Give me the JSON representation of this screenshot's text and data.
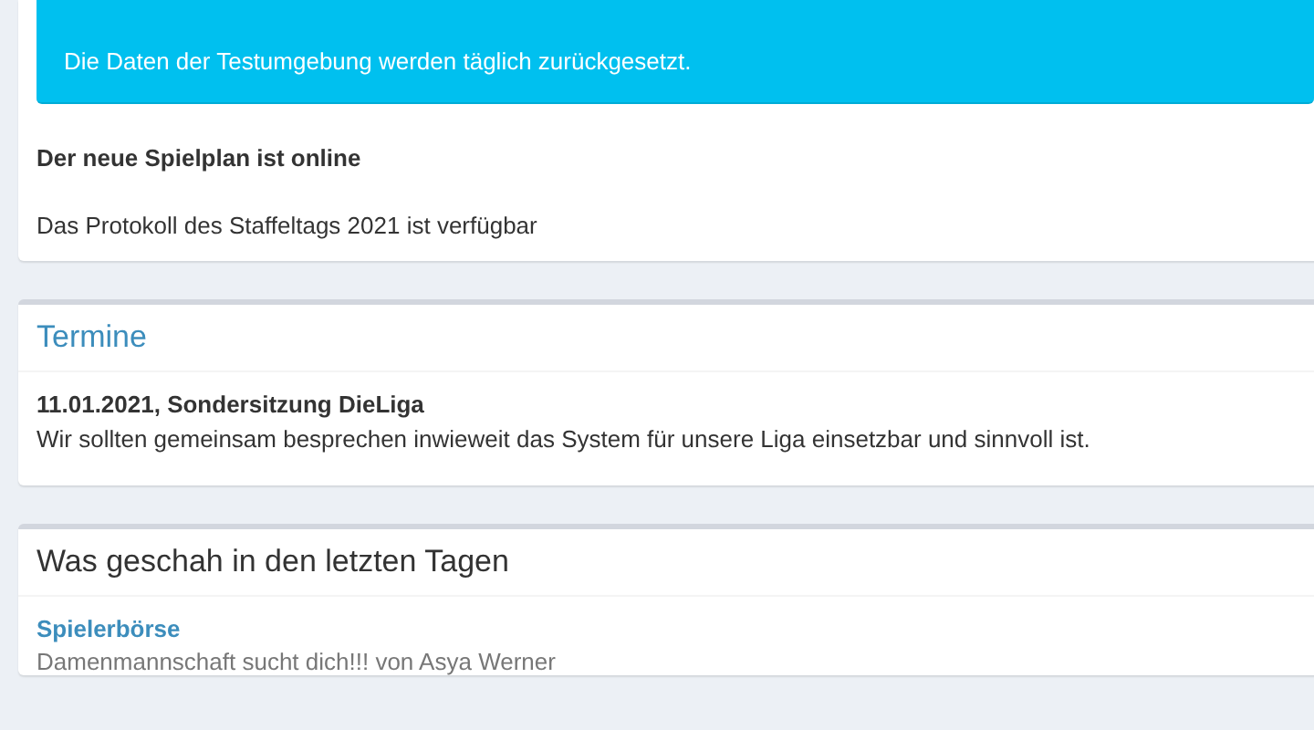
{
  "news_card": {
    "alert": "Die Daten der Testumgebung werden täglich zurückgesetzt.",
    "items": [
      {
        "text": "Der neue Spielplan ist online",
        "kind": "headline"
      },
      {
        "text": "Das Protokoll des Staffeltags 2021 ist verfügbar",
        "kind": "plain"
      }
    ]
  },
  "appointments": {
    "title": "Termine",
    "entries": [
      {
        "heading": "11.01.2021, Sondersitzung DieLiga",
        "text": "Wir sollten gemeinsam besprechen inwieweit das System für unsere Liga einsetzbar und sinnvoll ist."
      }
    ]
  },
  "recent": {
    "title": "Was geschah in den letzten Tagen",
    "entries": [
      {
        "link": "Spielerbörse",
        "text": "Damenmannschaft sucht dich!!! von Asya Werner"
      }
    ]
  }
}
